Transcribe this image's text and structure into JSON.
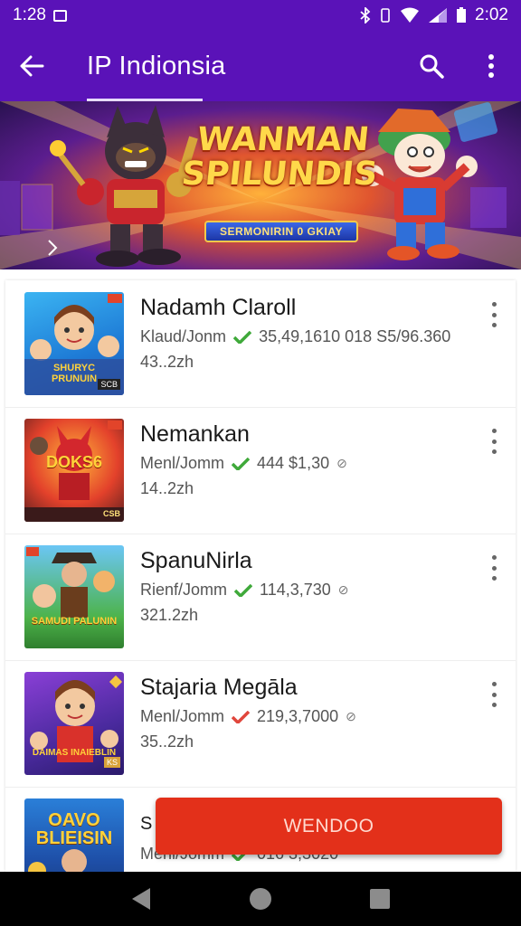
{
  "status_bar": {
    "time": "1:28",
    "right_time": "2:02"
  },
  "app_bar": {
    "title": "IP Indionsia"
  },
  "banner": {
    "title_line1": "WANMAN",
    "title_line2": "SPILUNDIS",
    "ribbon": "SERMONIRIN 0 GKIAY"
  },
  "items": [
    {
      "name": "Nadamh Claroll",
      "meta": "Klaud/Jonm",
      "stats": "35,49,1610  018 S5/96.360",
      "size": "43..2zh",
      "check_color": "#3fa93a",
      "thumb_text": "SHURYC PRUNUIN",
      "thumb_badge": "SCB"
    },
    {
      "name": "Nemankan",
      "meta": "Menl/Jomm",
      "stats": "444 $1,30",
      "size": "14..2zh",
      "check_color": "#3fa93a",
      "thumb_text": "DOKS6",
      "thumb_badge": "CSB"
    },
    {
      "name": "SpanuNirla",
      "meta": "Rienf/Jomm",
      "stats": "114,3,730",
      "size": "321.2zh",
      "check_color": "#3fa93a",
      "thumb_text": "SAMUDI PALUNIN",
      "thumb_badge": ""
    },
    {
      "name": "Stajaria Megāla",
      "meta": "Menl/Jomm",
      "stats": "219,3,7000",
      "size": "35..2zh",
      "check_color": "#e0463c",
      "thumb_text": "DAIMAS INAIEBLIN",
      "thumb_badge": "KS"
    },
    {
      "name": "S",
      "meta": "Menl/Jomm",
      "stats": "016 3,3020",
      "size": "",
      "check_color": "#3fa93a",
      "thumb_text": "OAVO BLIEISIN",
      "thumb_badge": ""
    }
  ],
  "fab": {
    "label": "WENDOO"
  },
  "colors": {
    "primary": "#5a12b8",
    "accent": "#e3301a"
  }
}
